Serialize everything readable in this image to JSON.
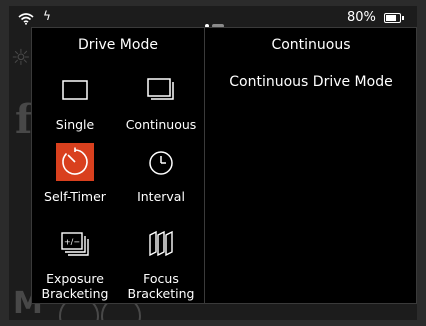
{
  "status_bar": {
    "battery_percent": "80%",
    "battery_level": 0.8,
    "icons": [
      "wifi-icon",
      "flash-icon",
      "page-indicator",
      "battery-icon"
    ]
  },
  "drive_mode": {
    "title": "Drive Mode",
    "options": [
      {
        "label": "Single",
        "icon": "single-frame-icon",
        "selected": false
      },
      {
        "label": "Continuous",
        "icon": "continuous-frames-icon",
        "selected": false
      },
      {
        "label": "Self-Timer",
        "icon": "self-timer-icon",
        "selected": true
      },
      {
        "label": "Interval",
        "icon": "interval-clock-icon",
        "selected": false
      },
      {
        "label": "Exposure Bracketing",
        "icon": "exposure-bracketing-icon",
        "selected": false
      },
      {
        "label": "Focus Bracketing",
        "icon": "focus-bracketing-icon",
        "selected": false
      }
    ]
  },
  "detail": {
    "title": "Continuous",
    "description": "Continuous Drive Mode"
  },
  "colors": {
    "accent": "#d9401e",
    "panel_bg": "#000000",
    "screen_bg": "#1c1c1c"
  }
}
